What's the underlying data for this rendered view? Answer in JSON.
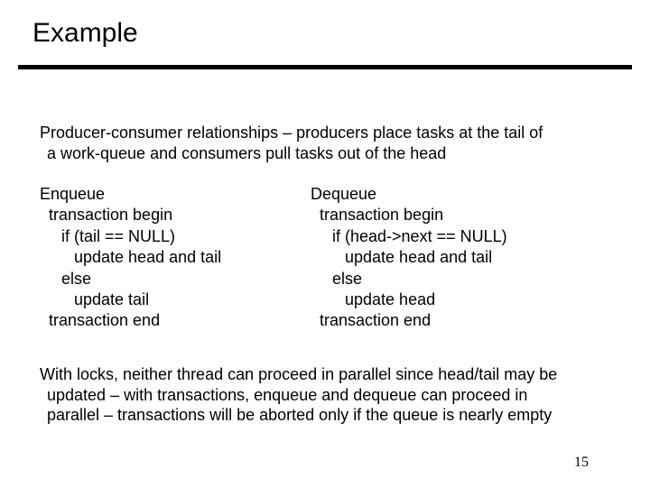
{
  "title": "Example",
  "intro": {
    "line1": "Producer-consumer relationships – producers place tasks at the tail of",
    "line2": "a work-queue and consumers pull tasks out of the head"
  },
  "enqueue": {
    "l0": "Enqueue",
    "l1": "transaction begin",
    "l2": "if (tail == NULL)",
    "l3": "update head and tail",
    "l4": "else",
    "l5": "update tail",
    "l6": "transaction end"
  },
  "dequeue": {
    "l0": "Dequeue",
    "l1": "transaction begin",
    "l2": "if (head->next == NULL)",
    "l3": "update head and tail",
    "l4": "else",
    "l5": "update head",
    "l6": "transaction end"
  },
  "conclusion": {
    "line1": "With locks, neither thread can proceed in parallel since head/tail may be",
    "line2": "updated – with transactions, enqueue and dequeue can proceed in",
    "line3": "parallel – transactions will be aborted only if the queue is nearly empty"
  },
  "page_number": "15"
}
